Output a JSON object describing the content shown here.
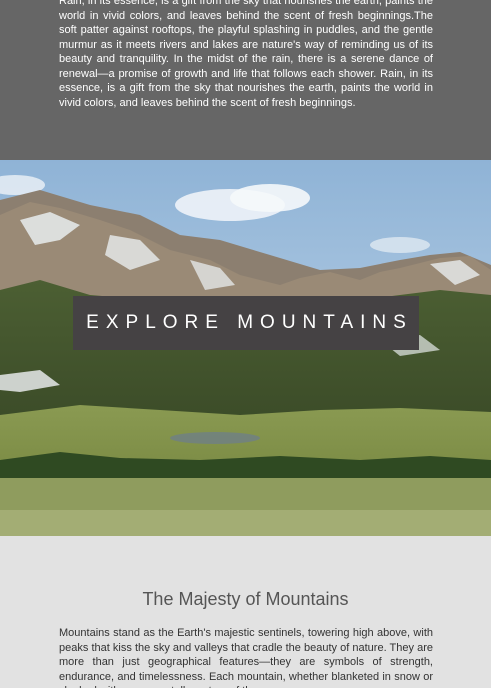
{
  "intro": {
    "paragraph": "Rain, in its essence, is a gift from the sky that nourishes the earth, paints the world in vivid colors, and leaves behind the scent of fresh beginnings.The soft patter against rooftops, the playful splashing in puddles, and the gentle murmur as it meets rivers and lakes are nature's way of reminding us of its beauty and tranquility. In the midst of the rain, there is a serene dance of renewal—a promise of growth and life that follows each shower. Rain, in its essence, is a gift from the sky that nourishes the earth, paints the world in vivid colors, and leaves behind the scent of fresh beginnings."
  },
  "hero": {
    "banner_text": "EXPLORE MOUNTAINS",
    "image": "mountain-landscape"
  },
  "section": {
    "title": "The Majesty of Mountains",
    "paragraph": "Mountains stand as the Earth's majestic sentinels, towering high above, with peaks that kiss the sky and valleys that cradle the beauty of nature. They are more than just geographical features—they are symbols of strength, endurance, and timelessness. Each mountain, whether blanketed in snow or cloaked with greenery, tells a story of the ages."
  },
  "colors": {
    "top_background": "#666666",
    "page_background": "#e2e2e2",
    "banner_background": "#454244",
    "title_color": "#555555"
  }
}
